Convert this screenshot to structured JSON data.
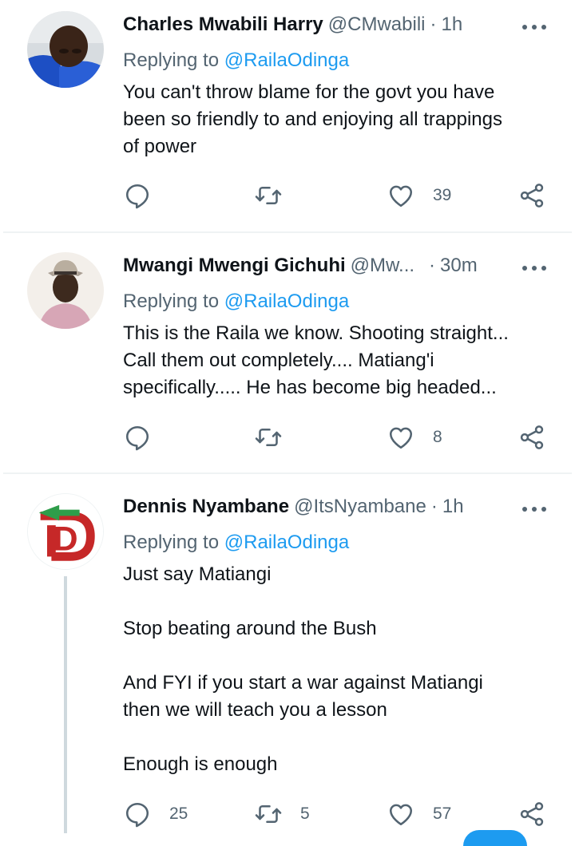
{
  "tweets": [
    {
      "name": "Charles Mwabili Harry",
      "handle": "@CMwabili",
      "time": "1h",
      "reply_prefix": "Replying to",
      "reply_mention": "@RailaOdinga",
      "lines": [
        "You can't throw blame for the govt you have",
        "been so friendly to and enjoying all trappings",
        "of power"
      ],
      "reply_count": "",
      "retweet_count": "",
      "like_count": "39"
    },
    {
      "name": "Mwangi Mwengi Gichuhi",
      "handle": "@Mw...",
      "time": "30m",
      "reply_prefix": "Replying to",
      "reply_mention": "@RailaOdinga",
      "lines": [
        "This is the Raila we know. Shooting straight...",
        "Call them out completely.... Matiang'i",
        "specifically..... He has become big headed..."
      ],
      "reply_count": "",
      "retweet_count": "",
      "like_count": "8"
    },
    {
      "name": "Dennis Nyambane",
      "handle": "@ItsNyambane",
      "time": "1h",
      "reply_prefix": "Replying to",
      "reply_mention": "@RailaOdinga",
      "paragraphs": [
        "Just say Matiangi",
        "Stop beating around the Bush",
        "And FYI if you start a war against Matiangi",
        "then we will teach you a lesson",
        "Enough is enough"
      ],
      "reply_count": "25",
      "retweet_count": "5",
      "like_count": "57",
      "avatar_logo_letter": "D"
    }
  ],
  "separator": "·",
  "colors": {
    "accent": "#1d9bf0",
    "muted": "#536471",
    "text": "#0f1419"
  }
}
